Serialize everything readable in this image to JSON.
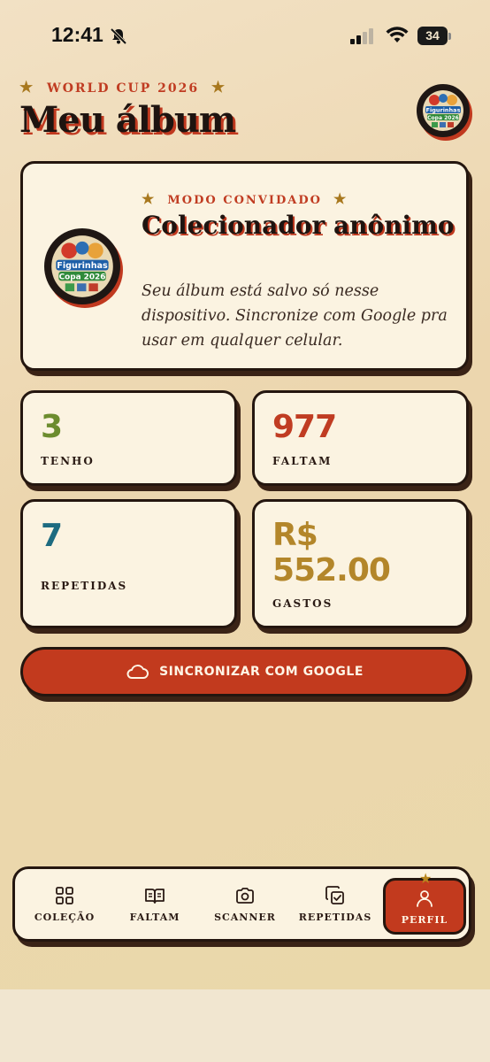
{
  "status_bar": {
    "time": "12:41",
    "battery": "34"
  },
  "header": {
    "kicker": "WORLD CUP 2026",
    "title": "Meu álbum"
  },
  "logo_text": {
    "line1": "Figurinhas",
    "line2": "Copa 2026"
  },
  "guest_card": {
    "kicker": "MODO CONVIDADO",
    "name": "Colecionador anônimo",
    "description": "Seu álbum está salvo só nesse dispositivo. Sincronize com Google pra usar em qualquer celular."
  },
  "stats": {
    "tenho": {
      "value": "3",
      "label": "TENHO",
      "color": "#6c8c2e"
    },
    "faltam": {
      "value": "977",
      "label": "FALTAM",
      "color": "#c03c22"
    },
    "repetidas": {
      "value": "7",
      "label": "REPETIDAS",
      "color": "#1d6b80"
    },
    "gastos": {
      "value_line1": "R$",
      "value_line2": "552.00",
      "label": "GASTOS",
      "color": "#b3862a"
    }
  },
  "sync_button": {
    "label": "SINCRONIZAR COM GOOGLE",
    "icon": "cloud-icon"
  },
  "nav": {
    "items": [
      {
        "label": "COLEÇÃO",
        "icon": "grid-icon"
      },
      {
        "label": "FALTAM",
        "icon": "open-book-icon"
      },
      {
        "label": "SCANNER",
        "icon": "camera-icon"
      },
      {
        "label": "REPETIDAS",
        "icon": "copy-check-icon"
      },
      {
        "label": "PERFIL",
        "icon": "user-icon",
        "active": true
      }
    ]
  },
  "colors": {
    "accent": "#c23a1e",
    "ink": "#24160f",
    "card": "#fbf3e1",
    "gold": "#a8781e"
  }
}
